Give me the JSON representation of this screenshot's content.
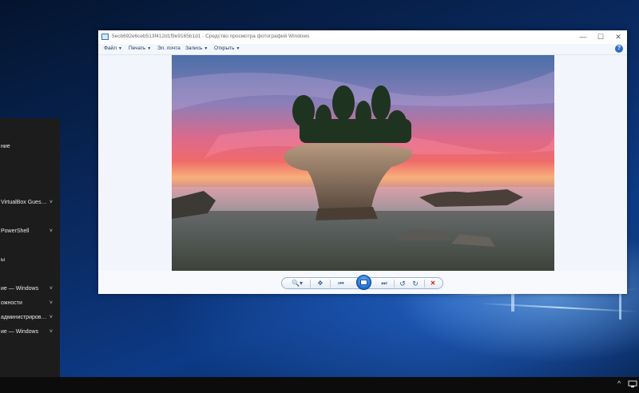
{
  "viewer": {
    "title": "5ecb692e6ceb513f412d1f9e9165b1d1 - Средство просмотра фотографий Windows",
    "menu": [
      {
        "label": "Файл"
      },
      {
        "label": "Печать"
      },
      {
        "label": "Эл. почта"
      },
      {
        "label": "Запись"
      },
      {
        "label": "Открыть"
      }
    ],
    "window_buttons": {
      "minimize": "—",
      "maximize": "☐",
      "close": "✕"
    },
    "help": "?",
    "photo_description_icon": "image",
    "controls": {
      "zoom": "🔍▾",
      "fit": "✥",
      "previous": "⏮",
      "next": "⏭",
      "rotate_ccw": "↺",
      "rotate_cw": "↻",
      "delete": "✕"
    }
  },
  "start_menu": {
    "items": [
      {
        "label": "ние",
        "chevron": ""
      },
      {
        "label": "VirtualBox Guest A...",
        "chevron": "˅"
      },
      {
        "label": "PowerShell",
        "chevron": "˅"
      },
      {
        "label": "ы",
        "chevron": ""
      },
      {
        "label": "ие — Windows",
        "chevron": "˅"
      },
      {
        "label": "ожности",
        "chevron": "˅"
      },
      {
        "label": "администрирован...",
        "chevron": "˅"
      },
      {
        "label": "ие — Windows",
        "chevron": "˅"
      }
    ]
  },
  "taskbar": {
    "tray_arrow": "^",
    "network_icon": "network-icon"
  },
  "colors": {
    "accent": "#2b5ea8",
    "taskbar": "#0c0c0c",
    "delete_red": "#d42020"
  }
}
